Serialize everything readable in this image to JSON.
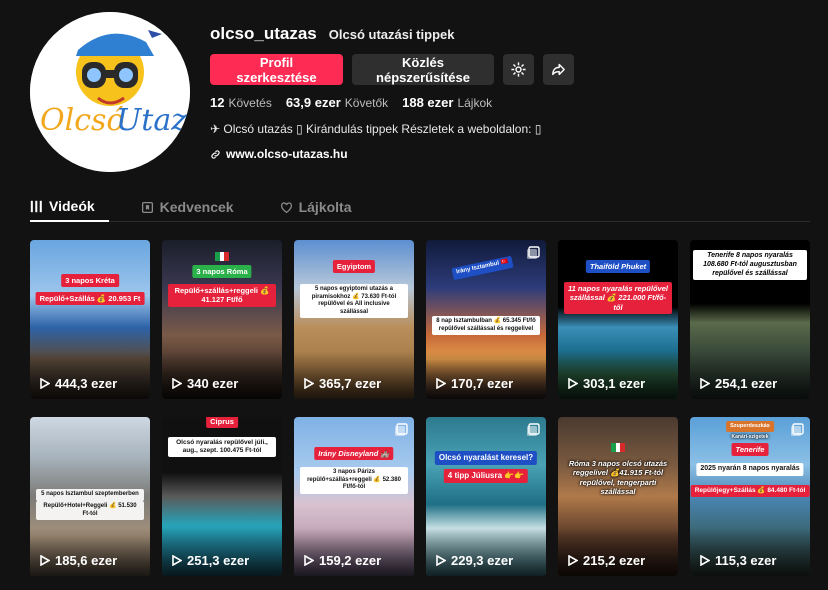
{
  "profile": {
    "username": "olcso_utazas",
    "nickname": "Olcsó utazási tippek",
    "avatar_text": "Olcsó Utazás",
    "edit_profile_label": "Profil szerkesztése",
    "promote_label": "Közlés népszerűsítése",
    "settings_icon": "gear-icon",
    "share_icon": "share-icon"
  },
  "stats": {
    "following_count": "12",
    "following_label": "Követés",
    "followers_count": "63,9 ezer",
    "followers_label": "Követők",
    "likes_count": "188 ezer",
    "likes_label": "Lájkok"
  },
  "bio": {
    "text": "✈ Olcsó utazás ▯ Kirándulás tippek Részletek a weboldalon: ▯",
    "link": "www.olcso-utazas.hu"
  },
  "tabs": [
    {
      "label": "Videók",
      "icon": "grid-icon",
      "active": true
    },
    {
      "label": "Kedvencek",
      "icon": "bookmark-icon",
      "active": false
    },
    {
      "label": "Lájkolta",
      "icon": "heart-icon",
      "active": false
    }
  ],
  "videos": [
    {
      "views": "444,3 ezer",
      "caption1": "3 napos Kréta",
      "caption2": "Repülő+Szállás 💰 20.953 Ft"
    },
    {
      "views": "340 ezer",
      "caption1": "3 napos Róma",
      "caption2": "Repülő+szállás+reggeli 💰 41.127 Ft/fő"
    },
    {
      "views": "365,7 ezer",
      "caption1": "Egyiptom",
      "caption2": "5 napos egyiptomi utazás a piramisokhoz 💰 73.630 Ft-tól repülővel és All inclusive szállással"
    },
    {
      "views": "170,7 ezer",
      "caption1": "Irány Isztambul 🇹🇷",
      "caption2": "8 nap Isztambulban 💰 65.345 Ft/fő repülővel szállással és reggelivel"
    },
    {
      "views": "303,1 ezer",
      "caption1": "Thaiföld Phuket",
      "caption2": "11 napos nyaralás repülővel szállással 💰 221.000 Ft/fő-től"
    },
    {
      "views": "254,1 ezer",
      "caption1": "Tenerife 8 napos nyaralás 108.680 Ft-tól augusztusban repülővel és szállással",
      "caption2": ""
    },
    {
      "views": "185,6 ezer",
      "caption1": "5 napos Isztambul szeptemberben",
      "caption2": "Repülő+Hotel+Reggeli 💰 51.530 Ft-tól"
    },
    {
      "views": "251,3 ezer",
      "caption1": "Ciprus",
      "caption2": "Olcsó nyaralás repülővel júli., aug., szept. 100.475 Ft-tól"
    },
    {
      "views": "159,2 ezer",
      "caption1": "Irány Disneyland 🏰",
      "caption2": "3 napos Párizs repülő+szállás+reggeli 💰 52.380 Ft/fő-tól"
    },
    {
      "views": "229,3 ezer",
      "caption1": "Olcsó nyaralást keresel?",
      "caption2": "4 tipp Júliusra 👉👉"
    },
    {
      "views": "215,2 ezer",
      "caption1": "Róma 3 napos olcsó utazás reggelivel 💰41.915 Ft-tól repülővel, tengerparti szállással",
      "caption2": ""
    },
    {
      "views": "115,3 ezer",
      "caption1": "Tenerife",
      "caption2": "2025 nyarán 8 napos nyaralás",
      "caption3": "Repülőjegy+Szállás 💰 84.480 Ft-tól",
      "tag": "Szuperdeszkás",
      "subtag": "Kanári-szigetek"
    }
  ]
}
